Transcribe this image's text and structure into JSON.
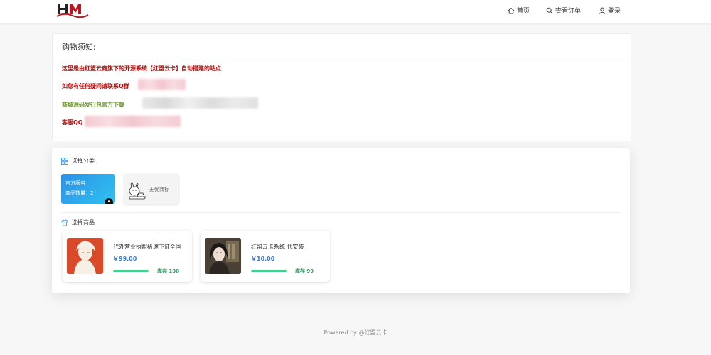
{
  "header": {
    "logo_icon": "hm-logo",
    "nav": [
      {
        "label": "首页",
        "icon": "home-icon"
      },
      {
        "label": "查看订单",
        "icon": "search-icon"
      },
      {
        "label": "登录",
        "icon": "user-icon"
      }
    ]
  },
  "notice": {
    "title": "购物须知:",
    "lines": [
      "这里是由红盟云商旗下的开源系统【红盟云卡】自动搭建的站点",
      "如您有任何疑问请联系Q群",
      "商城源码发行包官方下载",
      "客服QQ"
    ],
    "colors": {
      "red": "#b00b0b",
      "green": "#6f9533"
    }
  },
  "categories": {
    "heading": "选择分类",
    "items": [
      {
        "name": "官方服务",
        "count_label": "商品数量：2",
        "active": true
      },
      {
        "name": "无忧商标",
        "active": false
      }
    ]
  },
  "products": {
    "heading": "选择商品",
    "items": [
      {
        "name": "代办营业执照极速下证全国",
        "price": "￥99.00",
        "stock": "库存 100"
      },
      {
        "name": "红盟云卡系统 代安装",
        "price": "￥10.00",
        "stock": "库存 99"
      }
    ]
  },
  "footer": {
    "text": "Powered by @红盟云卡"
  }
}
